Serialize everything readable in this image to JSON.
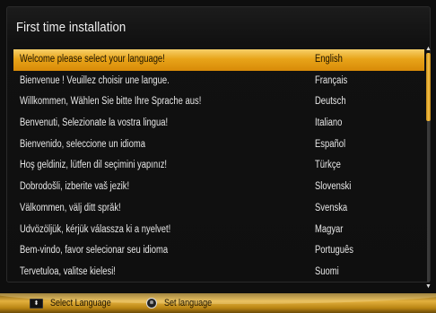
{
  "window": {
    "title": "First time installation"
  },
  "languages": [
    {
      "message": "Welcome please select your language!",
      "language": "English",
      "selected": true
    },
    {
      "message": "Bienvenue ! Veuillez choisir une langue.",
      "language": "Français",
      "selected": false
    },
    {
      "message": "Willkommen, Wählen Sie bitte Ihre Sprache aus!",
      "language": "Deutsch",
      "selected": false
    },
    {
      "message": "Benvenuti, Selezionate la vostra lingua!",
      "language": "Italiano",
      "selected": false
    },
    {
      "message": "Bienvenido, seleccione un idioma",
      "language": "Español",
      "selected": false
    },
    {
      "message": "Hoş geldiniz, lütfen dil seçimini yapınız!",
      "language": "Türkçe",
      "selected": false
    },
    {
      "message": "Dobrodošli, izberite vaš jezik!",
      "language": "Slovenski",
      "selected": false
    },
    {
      "message": "Välkommen, välj ditt språk!",
      "language": "Svenska",
      "selected": false
    },
    {
      "message": "Üdvözöljük, kérjük válassza ki a nyelvet!",
      "language": "Magyar",
      "selected": false
    },
    {
      "message": "Bem-vindo, favor selecionar seu idioma",
      "language": "Português",
      "selected": false
    },
    {
      "message": "Tervetuloa, valitse kielesi!",
      "language": "Suomi",
      "selected": false
    }
  ],
  "footer": {
    "select_label": "Select Language",
    "select_icon": "up-down-arrows-icon",
    "set_label": "Set language",
    "set_icon": "ok-button-icon"
  },
  "colors": {
    "highlight": "#e8a419",
    "footer": "#e3b13e",
    "background": "#0e0e0e"
  }
}
